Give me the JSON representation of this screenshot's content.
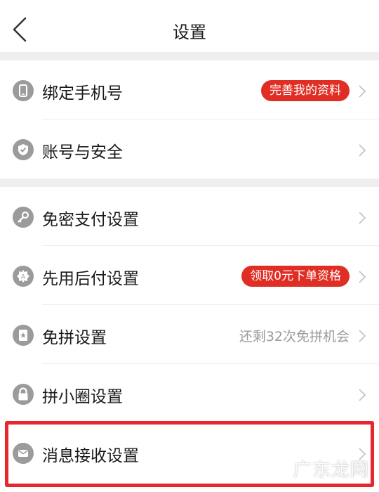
{
  "header": {
    "title": "设置",
    "back_icon": "chevron-left-icon"
  },
  "colors": {
    "accent": "#e02e24",
    "highlight": "#e8262e",
    "icon_gray": "#9b9b9b",
    "hint": "#9a9a9a"
  },
  "items": [
    {
      "id": "bind-phone",
      "label": "绑定手机号",
      "icon": "phone-icon",
      "badge": "完善我的资料"
    },
    {
      "id": "account-security",
      "label": "账号与安全",
      "icon": "shield-check-icon"
    },
    {
      "id": "password-free-pay",
      "label": "免密支付设置",
      "icon": "key-icon"
    },
    {
      "id": "pay-later",
      "label": "先用后付设置",
      "icon": "pay-later-icon",
      "badge": "领取0元下单资格"
    },
    {
      "id": "free-group",
      "label": "免拼设置",
      "icon": "card-star-icon",
      "hint": "还剩32次免拼机会"
    },
    {
      "id": "circle",
      "label": "拼小圈设置",
      "icon": "lock-icon"
    },
    {
      "id": "message",
      "label": "消息接收设置",
      "icon": "envelope-icon"
    }
  ],
  "watermark": "广东龙网"
}
